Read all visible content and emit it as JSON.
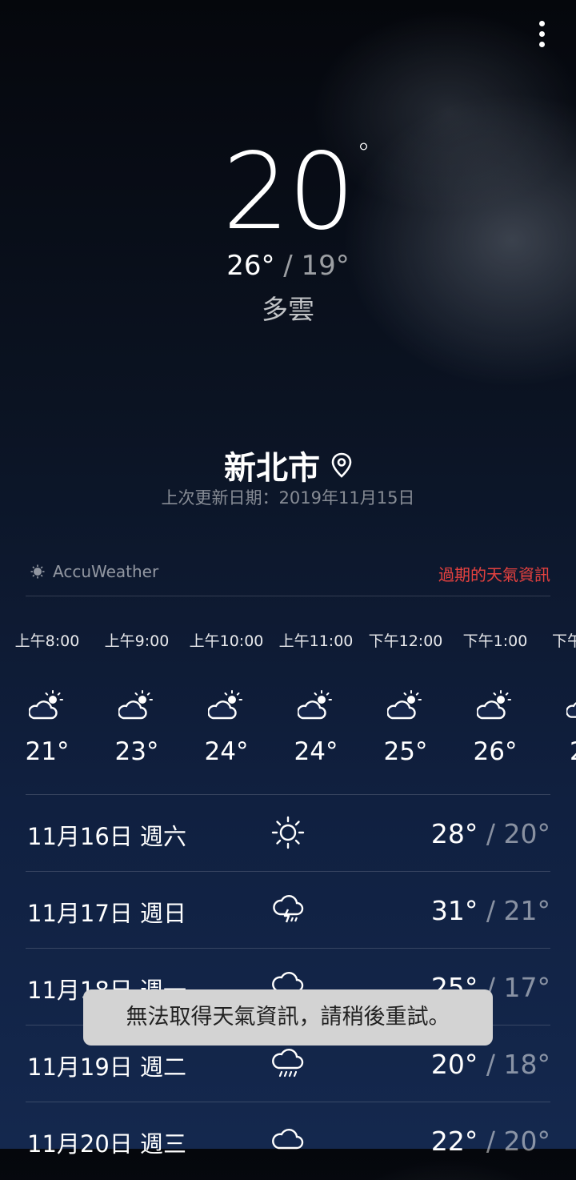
{
  "current": {
    "temp": "20",
    "degree_symbol": "°",
    "high": "26°",
    "low": "19°",
    "separator": " / ",
    "condition": "多雲"
  },
  "location": {
    "city": "新北市",
    "last_updated": "上次更新日期：2019年11月15日"
  },
  "provider": {
    "name": "AccuWeather",
    "expired_notice": "過期的天氣資訊"
  },
  "hourly": [
    {
      "time": "上午8:00",
      "icon": "partly-cloudy-icon",
      "temp": "21°"
    },
    {
      "time": "上午9:00",
      "icon": "partly-cloudy-icon",
      "temp": "23°"
    },
    {
      "time": "上午10:00",
      "icon": "partly-cloudy-icon",
      "temp": "24°"
    },
    {
      "time": "上午11:00",
      "icon": "partly-cloudy-icon",
      "temp": "24°"
    },
    {
      "time": "下午12:00",
      "icon": "partly-cloudy-icon",
      "temp": "25°"
    },
    {
      "time": "下午1:00",
      "icon": "partly-cloudy-icon",
      "temp": "26°"
    },
    {
      "time": "下午",
      "icon": "partly-cloudy-icon",
      "temp": "2"
    }
  ],
  "daily": [
    {
      "date": "11月16日 週六",
      "icon": "sun-icon",
      "high": "28°",
      "low": "20°"
    },
    {
      "date": "11月17日 週日",
      "icon": "thunderstorm-icon",
      "high": "31°",
      "low": "21°"
    },
    {
      "date": "11月18日 週一",
      "icon": "rain-cloud-icon",
      "high": "25°",
      "low": "17°"
    },
    {
      "date": "11月19日 週二",
      "icon": "rain-cloud-icon",
      "high": "20°",
      "low": "18°"
    },
    {
      "date": "11月20日 週三",
      "icon": "cloud-icon",
      "high": "22°",
      "low": "20°"
    }
  ],
  "toast": {
    "message": "無法取得天氣資訊，請稍後重試。"
  },
  "colors": {
    "accent_warning": "#e5413f",
    "toast_bg": "#d3d3d3",
    "icon_sun": "#ffffff"
  }
}
